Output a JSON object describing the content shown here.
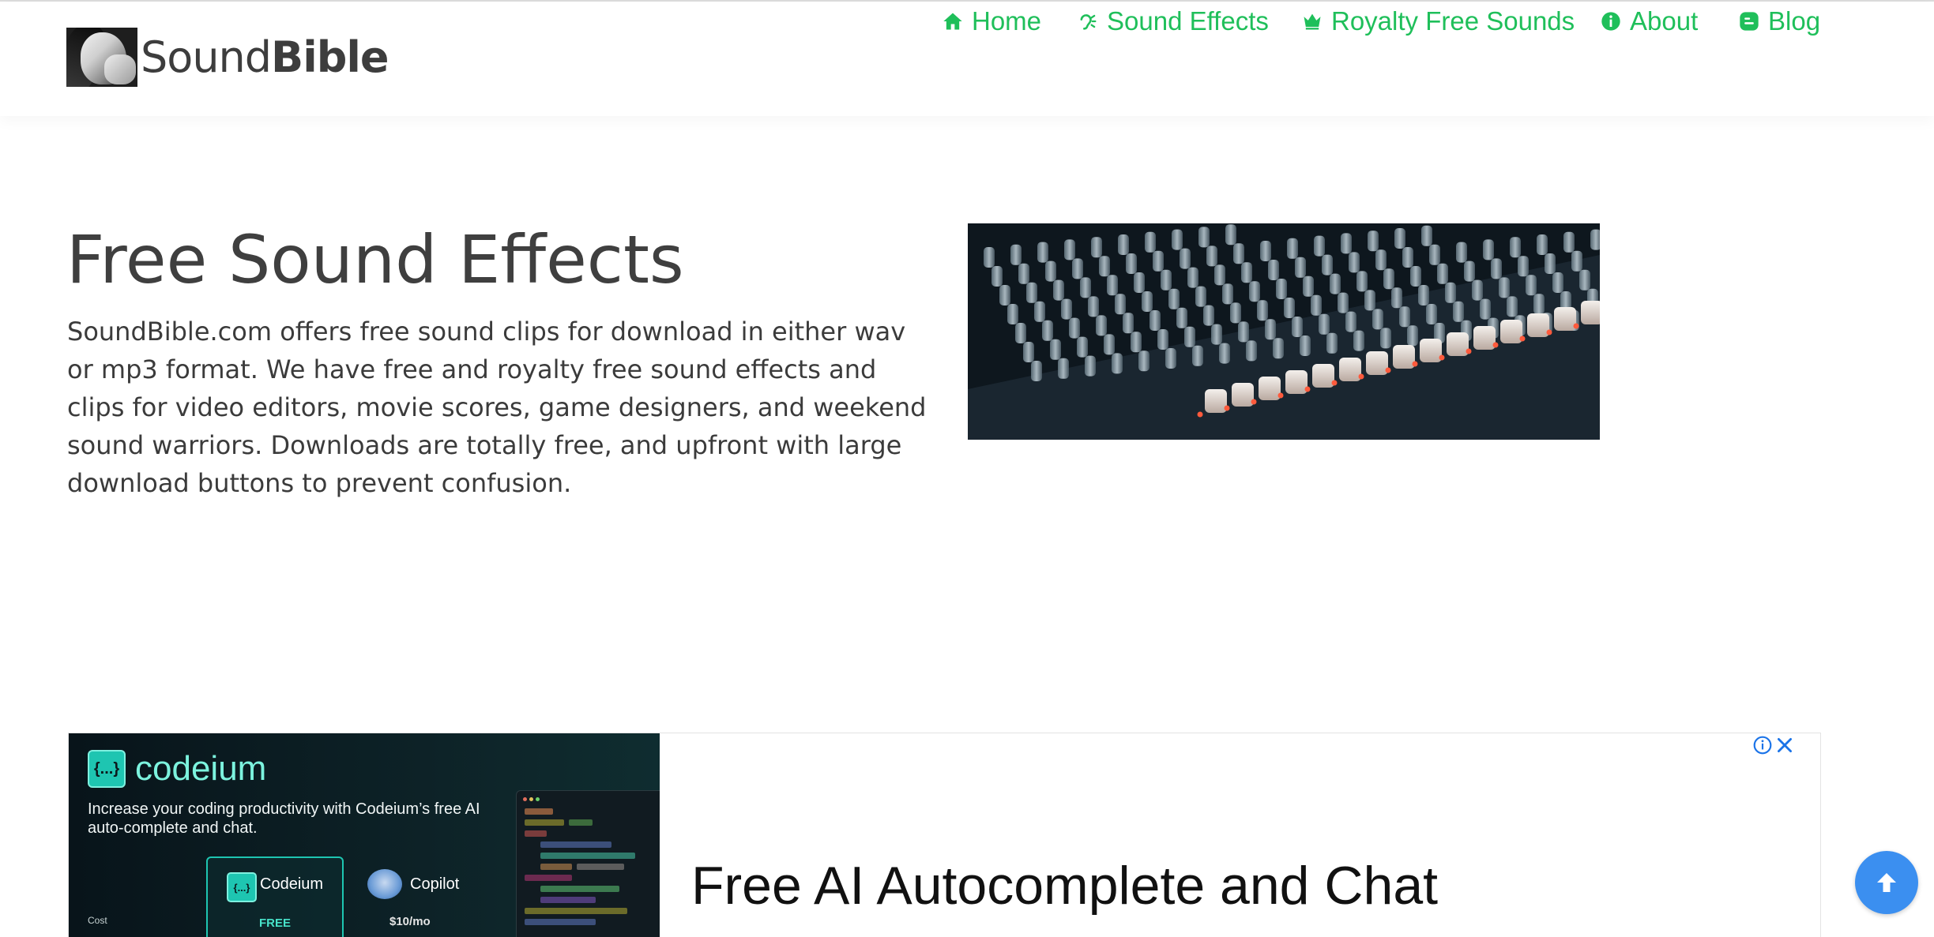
{
  "logo": {
    "text_regular": "Sound",
    "text_bold": "Bible",
    "image_alt": "SoundBible logo portrait"
  },
  "nav": {
    "items": [
      {
        "label": "Home",
        "icon": "home-icon"
      },
      {
        "label": "Sound Effects",
        "icon": "ear-icon"
      },
      {
        "label": "Royalty Free Sounds",
        "icon": "crown-icon"
      },
      {
        "label": "About",
        "icon": "info-circle-icon"
      },
      {
        "label": "Blog",
        "icon": "blogger-icon"
      }
    ]
  },
  "hero": {
    "title": "Free Sound Effects",
    "description": "SoundBible.com offers free sound clips for download in either wav or mp3 format. We have free and royalty free sound effects and clips for video editors, movie scores, game designers, and weekend sound warriors. Downloads are totally free, and upfront with large download buttons to prevent confusion.",
    "image_desc": "mixing console faders"
  },
  "ad": {
    "brand_icon_text": "{...}",
    "brand_name": "codeium",
    "description": "Increase your coding productivity with Codeium’s free AI auto-complete and chat.",
    "cost_label": "Cost",
    "option_a_name": "Codeium",
    "option_a_price": "FREE",
    "option_b_name": "Copilot",
    "option_b_price": "$10/mo",
    "headline": "Free AI Autocomplete and Chat"
  },
  "colors": {
    "nav_green": "#1fbf5a",
    "text_dark": "#3b3b3b",
    "scroll_button": "#3b8ff0",
    "ad_accent": "#1ec5b1"
  }
}
